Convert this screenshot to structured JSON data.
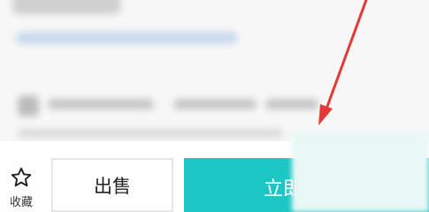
{
  "favorite": {
    "icon": "star-outline-icon",
    "label": "收藏"
  },
  "sell_button": {
    "label": "出售"
  },
  "buy_button": {
    "label": "立即"
  },
  "colors": {
    "buy_bg": "#1cc6c4",
    "arrow": "#e53935"
  }
}
